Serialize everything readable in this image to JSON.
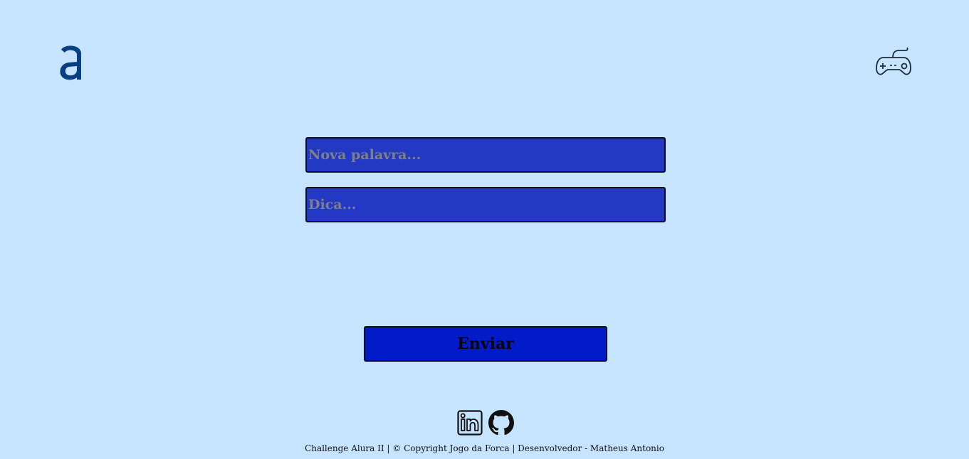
{
  "header": {
    "logo_icon": "alura-logo-icon",
    "game_icon": "gamepad-icon"
  },
  "form": {
    "word_placeholder": "Nova palavra...",
    "word_value": "",
    "hint_placeholder": "Dica...",
    "hint_value": "",
    "send_label": "Enviar"
  },
  "footer": {
    "social": [
      "linkedin-icon",
      "github-icon"
    ],
    "text": "Challenge Alura II | © Copyright Jogo da Forca | Desenvolvedor - Matheus Antonio"
  },
  "colors": {
    "background": "#c6e4fd",
    "field_bg": "#2339c3",
    "button_bg": "#001bc7",
    "brand": "#0b3f85"
  }
}
